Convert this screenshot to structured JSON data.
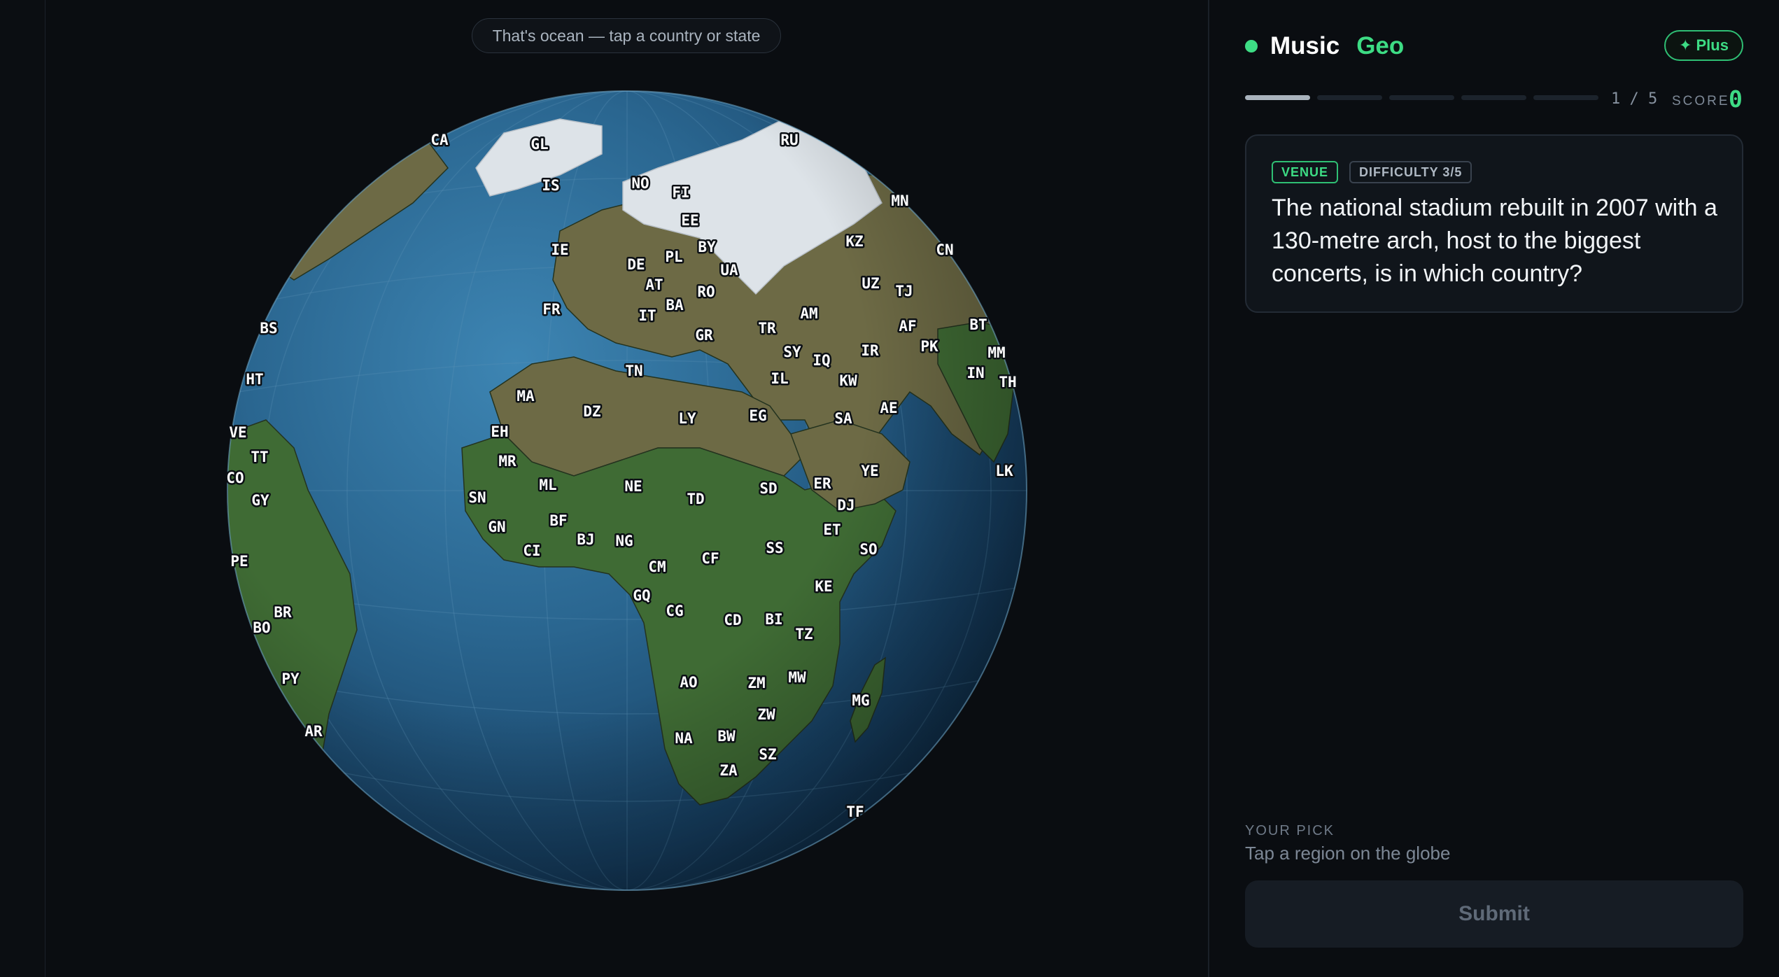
{
  "toast": {
    "text": "That's ocean — tap a country or state"
  },
  "brand": {
    "music": "Music",
    "geo": "Geo"
  },
  "plus": {
    "label": "Plus",
    "icon": "sparkle-icon"
  },
  "progress": {
    "current": 1,
    "total": 5,
    "text": "1 / 5"
  },
  "score": {
    "label": "SCORE",
    "value": "0"
  },
  "question": {
    "tags": [
      "VENUE",
      "DIFFICULTY 3/5"
    ],
    "text": "The national stadium rebuilt in 2007 with a 130-metre arch, host to the biggest concerts, is in which country?"
  },
  "pick": {
    "label": "YOUR PICK",
    "placeholder": "Tap a region on the globe"
  },
  "submit": {
    "label": "Submit"
  },
  "colors": {
    "accent": "#3ddc84",
    "ocean": "#1f5a82",
    "land_green": "#3f6b34",
    "land_olive": "#6d6a45",
    "ice": "#dde3e8"
  },
  "globe": {
    "labels": [
      "CA",
      "GL",
      "RU",
      "IS",
      "NO",
      "FI",
      "MN",
      "EE",
      "IE",
      "BY",
      "KZ",
      "CN",
      "DE",
      "PL",
      "UA",
      "AT",
      "RO",
      "UZ",
      "TJ",
      "BA",
      "FR",
      "AM",
      "IT",
      "BS",
      "AF",
      "BT",
      "TR",
      "GR",
      "SY",
      "PK",
      "IQ",
      "IR",
      "MM",
      "HT",
      "TN",
      "KW",
      "IL",
      "TH",
      "IN",
      "MA",
      "AE",
      "DZ",
      "EG",
      "SA",
      "LY",
      "VE",
      "EH",
      "TT",
      "MR",
      "YE",
      "LK",
      "ER",
      "ML",
      "NE",
      "SD",
      "CO",
      "TD",
      "DJ",
      "SN",
      "GY",
      "ET",
      "GN",
      "BF",
      "BJ",
      "NG",
      "SS",
      "CI",
      "SO",
      "CF",
      "CM",
      "PE",
      "KE",
      "GQ",
      "CG",
      "BR",
      "CD",
      "BI",
      "TZ",
      "BO",
      "AO",
      "MW",
      "ZM",
      "MG",
      "PY",
      "ZW",
      "NA",
      "BW",
      "AR",
      "SZ",
      "ZA",
      "TF"
    ]
  }
}
